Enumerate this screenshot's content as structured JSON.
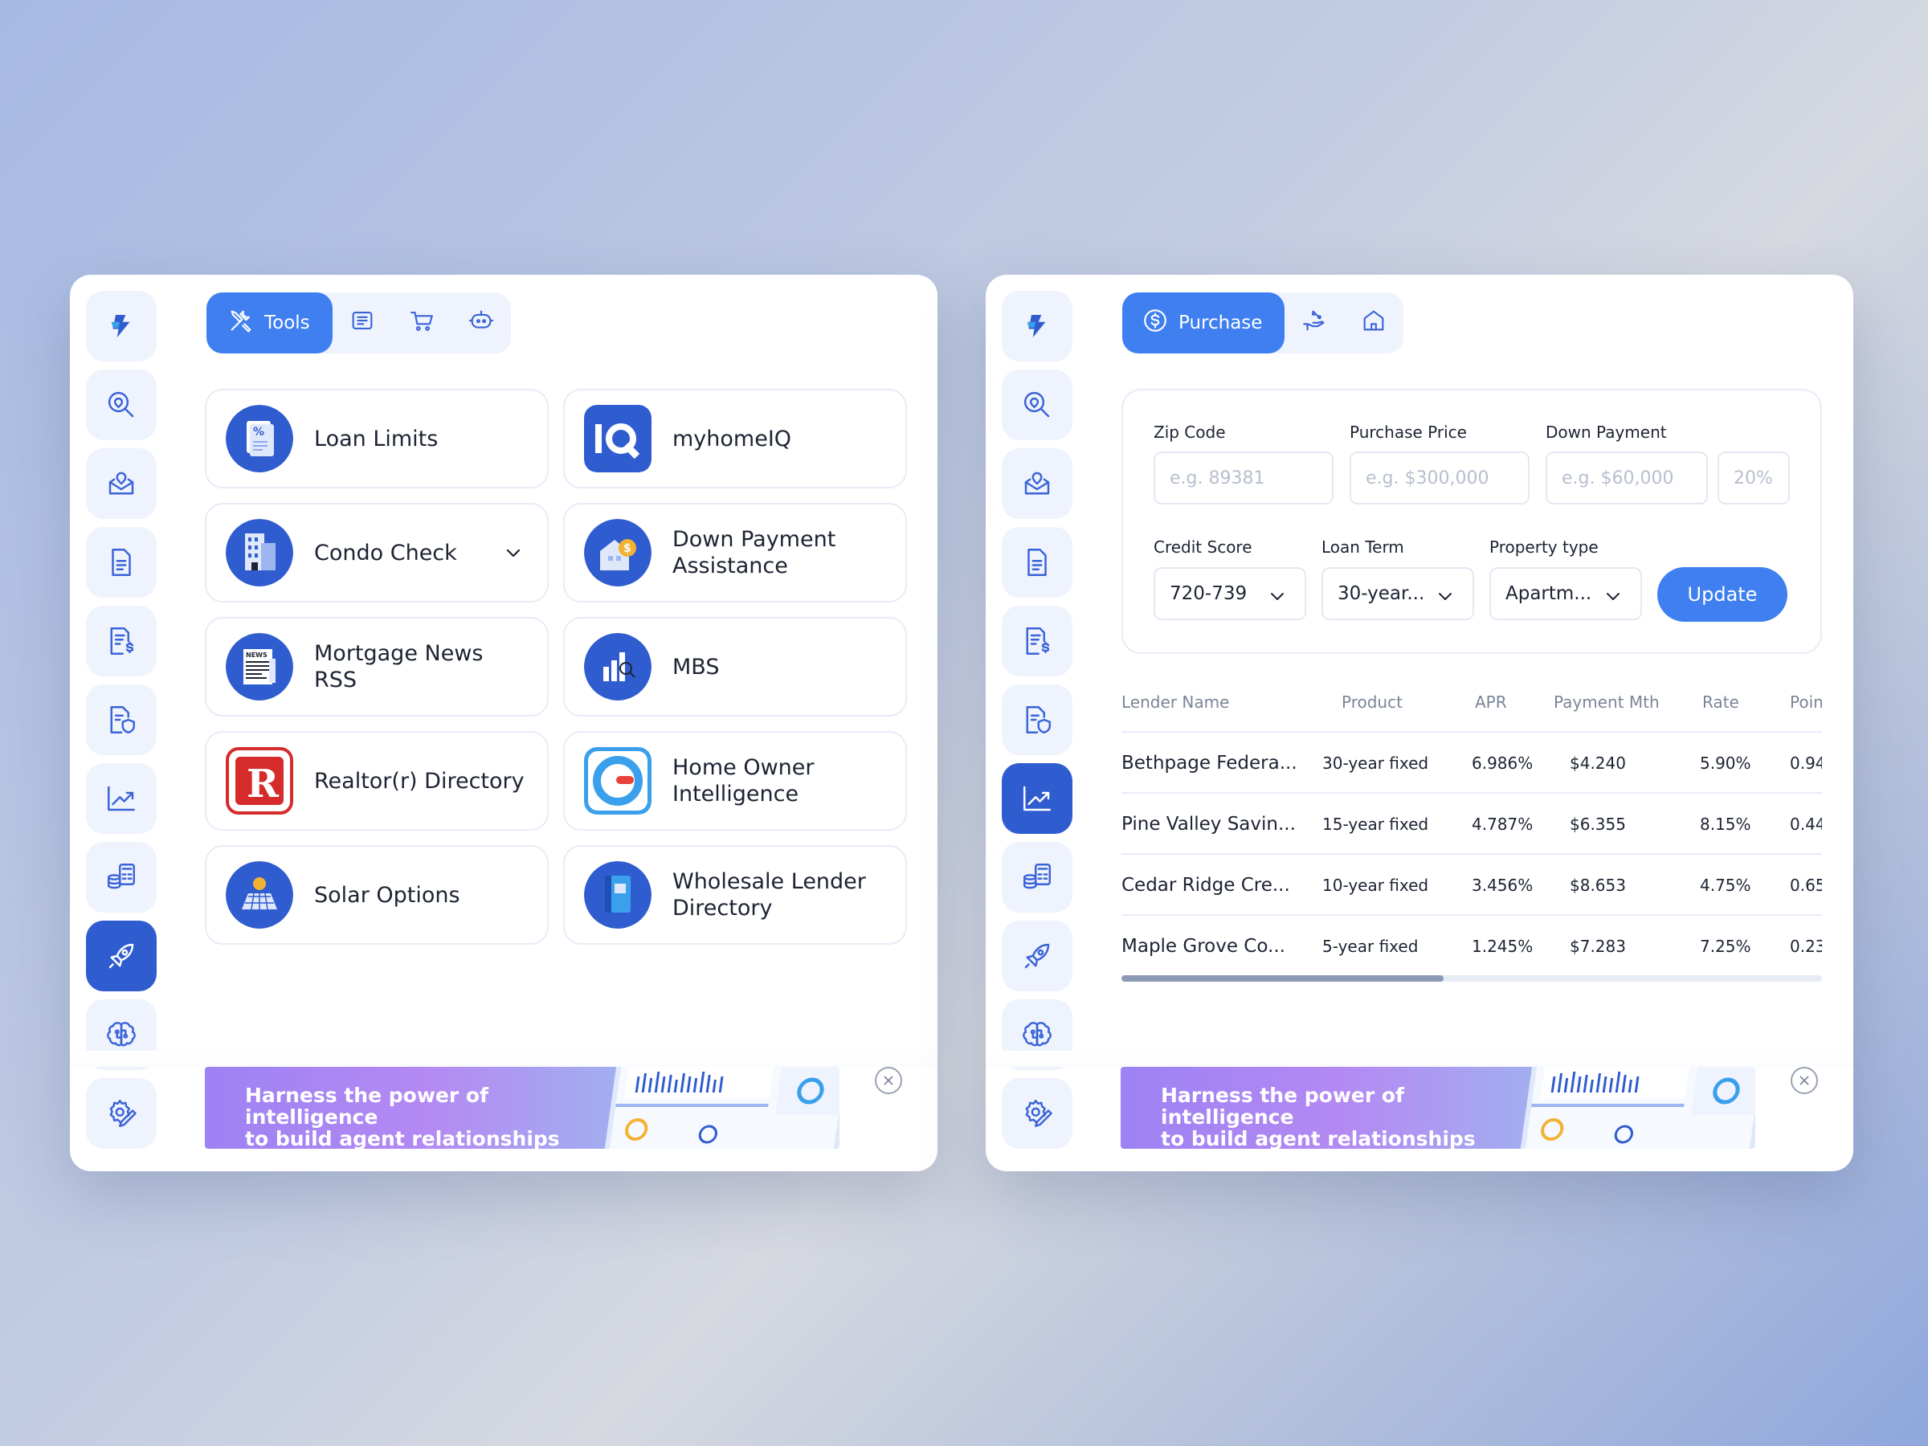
{
  "left_panel": {
    "tabs": [
      {
        "label": "Tools",
        "icon": "tools-icon",
        "active": true
      },
      {
        "label": "",
        "icon": "newspaper-icon"
      },
      {
        "label": "",
        "icon": "cart-icon"
      },
      {
        "label": "",
        "icon": "robot-icon"
      }
    ],
    "tools": [
      {
        "label": "Loan Limits",
        "logo": "loan-limits-logo"
      },
      {
        "label": "myhomeIQ",
        "logo": "myhomeiq-logo"
      },
      {
        "label": "Condo Check",
        "logo": "condo-check-logo",
        "has_dropdown": true
      },
      {
        "label": "Down Payment\nAssistance",
        "logo": "down-payment-logo"
      },
      {
        "label": "Mortgage News RSS",
        "logo": "news-logo"
      },
      {
        "label": "MBS",
        "logo": "mbs-logo"
      },
      {
        "label": "Realtor(r) Directory",
        "logo": "realtor-logo"
      },
      {
        "label": "Home Owner\nIntelligence",
        "logo": "home-owner-logo"
      },
      {
        "label": "Solar Options",
        "logo": "solar-logo"
      },
      {
        "label": "Wholesale Lender\nDirectory",
        "logo": "wholesale-logo"
      }
    ],
    "active_sidebar_index": 8
  },
  "right_panel": {
    "tabs": [
      {
        "label": "Purchase",
        "icon": "dollar-circle-icon",
        "active": true
      },
      {
        "label": "",
        "icon": "refinance-hand-icon"
      },
      {
        "label": "",
        "icon": "home-icon"
      }
    ],
    "form": {
      "zip_label": "Zip Code",
      "zip_placeholder": "e.g. 89381",
      "price_label": "Purchase Price",
      "price_placeholder": "e.g. $300,000",
      "down_label": "Down Payment",
      "down_placeholder": "e.g. $60,000",
      "down_percent": "20%",
      "credit_label": "Credit Score",
      "credit_value": "720-739",
      "term_label": "Loan Term",
      "term_value": "30-year...",
      "property_label": "Property type",
      "property_value": "Apartm...",
      "update_label": "Update"
    },
    "table": {
      "headers": [
        "Lender Name",
        "Product",
        "APR",
        "Payment Mth",
        "Rate",
        "Poin"
      ],
      "rows": [
        [
          "Bethpage Federa...",
          "30-year fixed",
          "6.986%",
          "$4.240",
          "5.90%",
          "0.94"
        ],
        [
          "Pine Valley Savin...",
          "15-year fixed",
          "4.787%",
          "$6.355",
          "8.15%",
          "0.44"
        ],
        [
          "Cedar Ridge Cre...",
          "10-year fixed",
          "3.456%",
          "$8.653",
          "4.75%",
          "0.65"
        ],
        [
          "Maple Grove Co...",
          "5-year fixed",
          "1.245%",
          "$7.283",
          "7.25%",
          "0.23"
        ]
      ],
      "scroll_fraction": 0.46
    },
    "active_sidebar_index": 6
  },
  "sidebar_icons": [
    "logo-icon",
    "search-location-icon",
    "mail-location-icon",
    "document-icon",
    "invoice-dollar-icon",
    "document-shield-icon",
    "chart-trend-icon",
    "calculator-coins-icon",
    "rocket-icon",
    "brain-icon",
    "settings-edit-icon"
  ],
  "banner": {
    "line1": "Harness the power of intelligence",
    "line2": "to build agent relationships"
  },
  "colors": {
    "accent": "#3f7ff0",
    "active_sidebar": "#2f5ccf",
    "icon": "#3a63d8"
  }
}
